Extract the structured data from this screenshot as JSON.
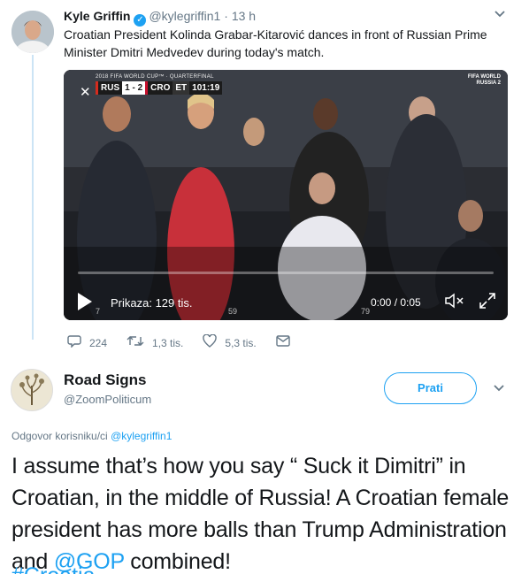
{
  "tweet1": {
    "name": "Kyle Griffin",
    "handle": "@kylegriffin1",
    "separator": "·",
    "time": "13 h",
    "text": "Croatian President Kolinda Grabar-Kitarović dances in front of Russian Prime Minister Dmitri Medvedev during today's match.",
    "video": {
      "tournament": "2018 FIFA WORLD CUP™ · QUARTERFINAL",
      "team1": "RUS",
      "score": "1 - 2",
      "team2": "CRO",
      "period": "ET",
      "clock": "101:19",
      "watermark_line1": "FIFA WORLD",
      "watermark_line2": "RUSSIA 2",
      "views": "Prikaza: 129 tis.",
      "time": "0:00 / 0:05",
      "overlay_left": "7",
      "overlay_mid": "59",
      "overlay_right": "79"
    },
    "actions": {
      "replies": "224",
      "retweets": "1,3 tis.",
      "likes": "5,3 tis."
    }
  },
  "tweet2": {
    "name": "Road Signs",
    "handle": "@ZoomPoliticum",
    "follow_label": "Prati",
    "reply_prefix": "Odgovor korisniku/ci",
    "reply_handle": "@kylegriffin1",
    "text_part1": "I assume that’s how you say “ Suck it Dimitri” in Croatian, in the middle of Russia! A Croatian female president has more balls than Trump Administration and ",
    "mention": "@GOP",
    "text_part2": " combined!",
    "next_line": "#Croatia"
  },
  "colors": {
    "accent": "#1da1f2",
    "muted": "#657786",
    "text": "#14171a",
    "thread_line": "#cce4f5"
  }
}
